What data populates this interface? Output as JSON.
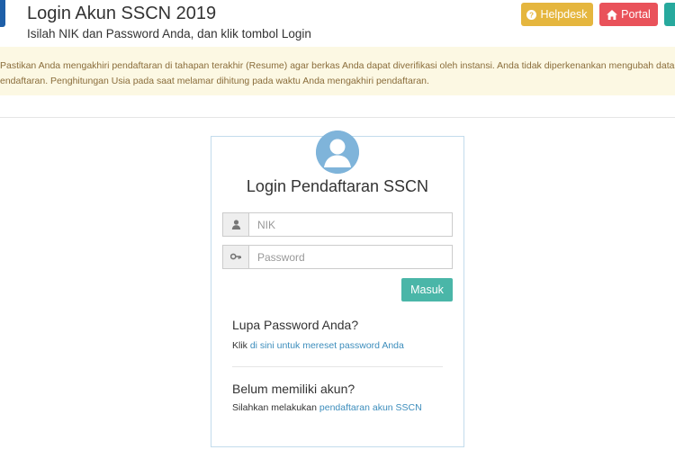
{
  "header": {
    "title": "Login Akun SSCN 2019",
    "subtitle": "Isilah NIK dan Password Anda, dan klik tombol Login",
    "helpdesk_label": "Helpdesk",
    "portal_label": "Portal"
  },
  "alert": {
    "line1": "Pastikan Anda mengakhiri pendaftaran di tahapan terakhir (Resume) agar berkas Anda dapat diverifikasi oleh instansi. Anda tidak diperkenankan mengubah data setel",
    "line2": "endaftaran. Penghitungan Usia pada saat melamar dihitung pada waktu Anda mengakhiri pendaftaran."
  },
  "login": {
    "title": "Login Pendaftaran SSCN",
    "nik_placeholder": "NIK",
    "password_placeholder": "Password",
    "submit_label": "Masuk"
  },
  "forgot": {
    "heading": "Lupa Password Anda?",
    "prefix": "Klik ",
    "link": "di sini untuk mereset password Anda"
  },
  "register": {
    "heading": "Belum memiliki akun?",
    "prefix": "Silahkan melakukan ",
    "link": "pendaftaran akun SSCN"
  },
  "colors": {
    "helpdesk": "#e5b63e",
    "portal": "#e9525a",
    "submit": "#4ab6a8",
    "alert_bg": "#fcf8e3",
    "alert_text": "#8a6d3b",
    "link": "#3c8dbc"
  },
  "icons": {
    "helpdesk": "question-circle-icon",
    "portal": "home-icon",
    "nik": "user-icon",
    "password": "key-icon",
    "avatar": "user-avatar-icon"
  }
}
